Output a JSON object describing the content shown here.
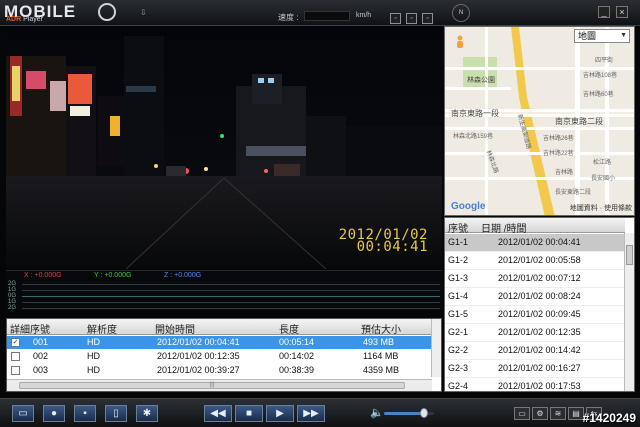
{
  "app": {
    "logo": "MOBILE",
    "logo_sub_brand": "ADR",
    "logo_sub": "Player"
  },
  "titlebar": {
    "speed_label": "速度 :",
    "speed_unit": "km/h",
    "compass": "N",
    "icons": [
      "download-icon",
      "window-mode-icon",
      "fullscreen-icon",
      "export-icon",
      "compass-icon",
      "minimize-icon",
      "close-icon"
    ],
    "minimize": "_",
    "close": "×"
  },
  "video": {
    "date": "2012/01/02",
    "time": "00:04:41"
  },
  "gsensor": {
    "x_label": "X : +0.000G",
    "y_label": "Y : +0.000G",
    "z_label": "Z : +0.000G",
    "scale": [
      "2G",
      "1G",
      "0G",
      "1G",
      "2G"
    ],
    "colors": {
      "x": "#e04040",
      "y": "#3ccc3c",
      "z": "#5a86ff"
    }
  },
  "file_table": {
    "headers": [
      "詳細序號",
      "解析度",
      "開始時間",
      "長度",
      "預估大小"
    ],
    "rows": [
      {
        "checked": true,
        "id": "001",
        "res": "HD",
        "start": "2012/01/02 00:04:41",
        "length": "00:05:14",
        "size": "493 MB",
        "selected": true
      },
      {
        "checked": false,
        "id": "002",
        "res": "HD",
        "start": "2012/01/02 00:12:35",
        "length": "00:14:02",
        "size": "1164 MB",
        "selected": false
      },
      {
        "checked": false,
        "id": "003",
        "res": "HD",
        "start": "2012/01/02 00:39:27",
        "length": "00:38:39",
        "size": "4359 MB",
        "selected": false
      }
    ],
    "hscroll_grip": "|||"
  },
  "map": {
    "mode": "地圖",
    "labels": {
      "park": "林森公園",
      "road1": "南京東路一段",
      "road2": "南京東路二段",
      "road3": "林森北路159巷",
      "road4": "新生高架道路",
      "l1": "吉林路108巷",
      "l2": "四平街",
      "l3": "吉林路26巷",
      "l4": "吉林路22巷",
      "l5": "吉林路60巷",
      "l6": "林森北路",
      "l7": "長安國小",
      "l8": "松江路",
      "l9": "吉林路",
      "l10": "長安東路二段"
    },
    "google": "Google",
    "footer": "地圖資料 · 使用條款"
  },
  "gps_list": {
    "headers": [
      "序號",
      "日期 /時間"
    ],
    "rows": [
      {
        "id": "G1-1",
        "dt": "2012/01/02 00:04:41",
        "selected": true
      },
      {
        "id": "G1-2",
        "dt": "2012/01/02 00:05:58"
      },
      {
        "id": "G1-3",
        "dt": "2012/01/02 00:07:12"
      },
      {
        "id": "G1-4",
        "dt": "2012/01/02 00:08:24"
      },
      {
        "id": "G1-5",
        "dt": "2012/01/02 00:09:45"
      },
      {
        "id": "G2-1",
        "dt": "2012/01/02 00:12:35"
      },
      {
        "id": "G2-2",
        "dt": "2012/01/02 00:14:42"
      },
      {
        "id": "G2-3",
        "dt": "2012/01/02 00:16:27"
      },
      {
        "id": "G2-4",
        "dt": "2012/01/02 00:17:53"
      }
    ]
  },
  "controls": {
    "left": [
      {
        "name": "open-folder-button",
        "glyph": "▭"
      },
      {
        "name": "snapshot-button",
        "glyph": "●"
      },
      {
        "name": "save-button",
        "glyph": "▪"
      },
      {
        "name": "delete-button",
        "glyph": "▯"
      },
      {
        "name": "settings-button",
        "glyph": "✱"
      }
    ],
    "transport": [
      {
        "name": "rewind-button",
        "glyph": "◀◀"
      },
      {
        "name": "stop-button",
        "glyph": "■"
      },
      {
        "name": "play-button",
        "glyph": "▶"
      },
      {
        "name": "fast-forward-button",
        "glyph": "▶▶"
      }
    ],
    "volume_icon": "🔈",
    "volume_level": 0.8,
    "right": [
      {
        "name": "view-mode-1-button",
        "glyph": "▭"
      },
      {
        "name": "view-mode-2-button",
        "glyph": "⚙"
      },
      {
        "name": "view-mode-3-button",
        "glyph": "≋"
      },
      {
        "name": "view-mode-4-button",
        "glyph": "▤"
      },
      {
        "name": "view-mode-5-button",
        "glyph": "⇆"
      }
    ]
  },
  "watermark": "#1420249"
}
